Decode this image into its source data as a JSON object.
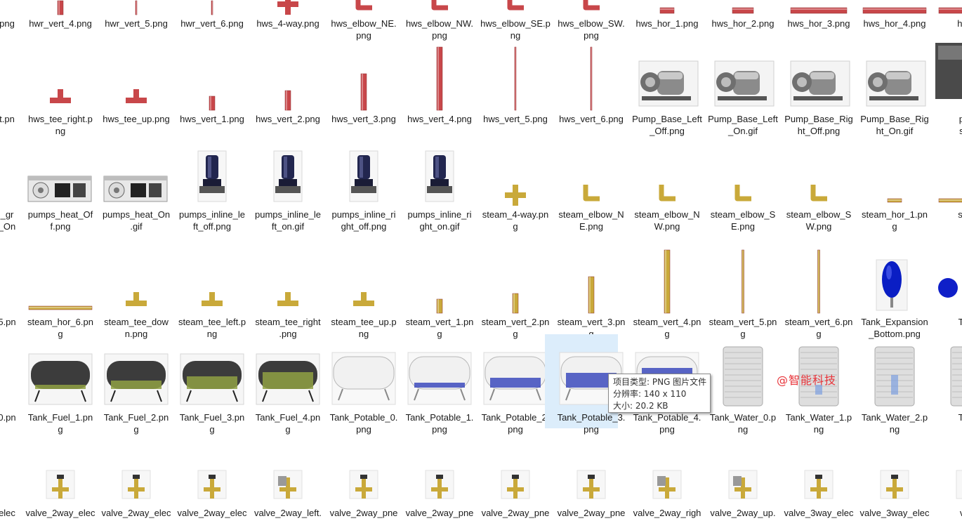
{
  "watermark": "@智能科技",
  "tooltip": {
    "type_line": "项目类型: PNG 图片文件",
    "resolution_line": "分辨率: 140 x 110",
    "size_line": "大小: 20.2 KB"
  },
  "selected_tile": "Tank_Potable_3.png",
  "colors": {
    "pipe_red": "#c8474a",
    "pipe_gold": "#c9a93a",
    "selection": "#dcedfb"
  },
  "rows": [
    {
      "items": [
        {
          "label": "png",
          "icon": "cut-icon"
        },
        {
          "label": "hwr_vert_4.png",
          "icon": "red-vertical-pipe-icon"
        },
        {
          "label": "hwr_vert_5.png",
          "icon": "red-vertical-pipe-icon"
        },
        {
          "label": "hwr_vert_6.png",
          "icon": "red-vertical-pipe-icon"
        },
        {
          "label": "hws_4-way.png",
          "icon": "red-cross-pipe-icon"
        },
        {
          "label": "hws_elbow_NE.\npng",
          "icon": "red-elbow-pipe-icon"
        },
        {
          "label": "hws_elbow_NW.\npng",
          "icon": "red-elbow-pipe-icon"
        },
        {
          "label": "hws_elbow_SE.p\nng",
          "icon": "red-elbow-pipe-icon"
        },
        {
          "label": "hws_elbow_SW.\npng",
          "icon": "red-elbow-pipe-icon"
        },
        {
          "label": "hws_hor_1.png",
          "icon": "red-horizontal-pipe-icon"
        },
        {
          "label": "hws_hor_2.png",
          "icon": "red-horizontal-pipe-icon"
        },
        {
          "label": "hws_hor_3.png",
          "icon": "red-horizontal-pipe-icon"
        },
        {
          "label": "hws_hor_4.png",
          "icon": "red-horizontal-pipe-icon"
        },
        {
          "label": "hws_h",
          "icon": "red-horizontal-pipe-icon"
        }
      ]
    },
    {
      "items": [
        {
          "label": "t.pn",
          "icon": "cut-icon"
        },
        {
          "label": "hws_tee_right.p\nng",
          "icon": "red-tee-pipe-icon"
        },
        {
          "label": "hws_tee_up.png",
          "icon": "red-tee-pipe-icon"
        },
        {
          "label": "hws_vert_1.png",
          "icon": "red-vertical-pipe-icon"
        },
        {
          "label": "hws_vert_2.png",
          "icon": "red-vertical-pipe-icon"
        },
        {
          "label": "hws_vert_3.png",
          "icon": "red-vertical-pipe-icon"
        },
        {
          "label": "hws_vert_4.png",
          "icon": "red-vertical-pipe-icon"
        },
        {
          "label": "hws_vert_5.png",
          "icon": "red-vertical-pipe-icon"
        },
        {
          "label": "hws_vert_6.png",
          "icon": "red-vertical-pipe-icon"
        },
        {
          "label": "Pump_Base_Left\n_Off.png",
          "icon": "pump-base-icon"
        },
        {
          "label": "Pump_Base_Left\n_On.gif",
          "icon": "pump-base-icon"
        },
        {
          "label": "Pump_Base_Rig\nht_Off.png",
          "icon": "pump-base-icon"
        },
        {
          "label": "Pump_Base_Rig\nht_On.gif",
          "icon": "pump-base-icon"
        },
        {
          "label": "pump\nsourc",
          "icon": "pump-source-icon"
        }
      ]
    },
    {
      "items": [
        {
          "label": "_gr\n_On",
          "icon": "cut-icon"
        },
        {
          "label": "pumps_heat_Of\nf.png",
          "icon": "heat-pump-unit-icon"
        },
        {
          "label": "pumps_heat_On\n.gif",
          "icon": "heat-pump-unit-icon"
        },
        {
          "label": "pumps_inline_le\nft_off.png",
          "icon": "inline-pump-icon"
        },
        {
          "label": "pumps_inline_le\nft_on.gif",
          "icon": "inline-pump-icon"
        },
        {
          "label": "pumps_inline_ri\nght_off.png",
          "icon": "inline-pump-icon"
        },
        {
          "label": "pumps_inline_ri\nght_on.gif",
          "icon": "inline-pump-icon"
        },
        {
          "label": "steam_4-way.pn\ng",
          "icon": "gold-cross-pipe-icon"
        },
        {
          "label": "steam_elbow_N\nE.png",
          "icon": "gold-elbow-pipe-icon"
        },
        {
          "label": "steam_elbow_N\nW.png",
          "icon": "gold-elbow-pipe-icon"
        },
        {
          "label": "steam_elbow_S\nE.png",
          "icon": "gold-elbow-pipe-icon"
        },
        {
          "label": "steam_elbow_S\nW.png",
          "icon": "gold-elbow-pipe-icon"
        },
        {
          "label": "steam_hor_1.pn\ng",
          "icon": "gold-horizontal-pipe-icon"
        },
        {
          "label": "steam",
          "icon": "gold-horizontal-pipe-icon"
        }
      ]
    },
    {
      "items": [
        {
          "label": "5.pn",
          "icon": "cut-icon"
        },
        {
          "label": "steam_hor_6.pn\ng",
          "icon": "gold-horizontal-pipe-icon"
        },
        {
          "label": "steam_tee_dow\nn.png",
          "icon": "gold-tee-pipe-icon"
        },
        {
          "label": "steam_tee_left.p\nng",
          "icon": "gold-tee-pipe-icon"
        },
        {
          "label": "steam_tee_right\n.png",
          "icon": "gold-tee-pipe-icon"
        },
        {
          "label": "steam_tee_up.p\nng",
          "icon": "gold-tee-pipe-icon"
        },
        {
          "label": "steam_vert_1.pn\ng",
          "icon": "gold-vertical-pipe-icon"
        },
        {
          "label": "steam_vert_2.pn\ng",
          "icon": "gold-vertical-pipe-icon"
        },
        {
          "label": "steam_vert_3.pn\ng",
          "icon": "gold-vertical-pipe-icon"
        },
        {
          "label": "steam_vert_4.pn\ng",
          "icon": "gold-vertical-pipe-icon"
        },
        {
          "label": "steam_vert_5.pn\ng",
          "icon": "gold-vertical-pipe-icon"
        },
        {
          "label": "steam_vert_6.pn\ng",
          "icon": "gold-vertical-pipe-icon"
        },
        {
          "label": "Tank_Expansion\n_Bottom.png",
          "icon": "expansion-tank-icon"
        },
        {
          "label": "Tank_\n_Le",
          "icon": "expansion-tank-icon"
        }
      ]
    },
    {
      "items": [
        {
          "label": "0.pn",
          "icon": "cut-icon"
        },
        {
          "label": "Tank_Fuel_1.pn\ng",
          "icon": "fuel-tank-icon"
        },
        {
          "label": "Tank_Fuel_2.pn\ng",
          "icon": "fuel-tank-icon"
        },
        {
          "label": "Tank_Fuel_3.pn\ng",
          "icon": "fuel-tank-icon"
        },
        {
          "label": "Tank_Fuel_4.pn\ng",
          "icon": "fuel-tank-icon"
        },
        {
          "label": "Tank_Potable_0.\npng",
          "icon": "potable-tank-icon"
        },
        {
          "label": "Tank_Potable_1.\npng",
          "icon": "potable-tank-icon"
        },
        {
          "label": "Tank_Potable_2.\npng",
          "icon": "potable-tank-icon"
        },
        {
          "label": "Tank_Potable_3.\npng",
          "icon": "potable-tank-icon"
        },
        {
          "label": "Tank_Potable_4.\npng",
          "icon": "potable-tank-icon"
        },
        {
          "label": "Tank_Water_0.p\nng",
          "icon": "water-tank-icon"
        },
        {
          "label": "Tank_Water_1.p\nng",
          "icon": "water-tank-icon"
        },
        {
          "label": "Tank_Water_2.p\nng",
          "icon": "water-tank-icon"
        },
        {
          "label": "Tank_",
          "icon": "water-tank-icon"
        }
      ]
    },
    {
      "items": [
        {
          "label": "elec",
          "icon": "cut-icon"
        },
        {
          "label": "valve_2way_elec",
          "icon": "valve-icon"
        },
        {
          "label": "valve_2way_elec",
          "icon": "valve-icon"
        },
        {
          "label": "valve_2way_elec",
          "icon": "valve-icon"
        },
        {
          "label": "valve_2way_left.",
          "icon": "valve-actuator-icon"
        },
        {
          "label": "valve_2way_pne",
          "icon": "valve-icon"
        },
        {
          "label": "valve_2way_pne",
          "icon": "valve-icon"
        },
        {
          "label": "valve_2way_pne",
          "icon": "valve-icon"
        },
        {
          "label": "valve_2way_pne",
          "icon": "valve-icon"
        },
        {
          "label": "valve_2way_righ",
          "icon": "valve-actuator-icon"
        },
        {
          "label": "valve_2way_up.",
          "icon": "valve-actuator-icon"
        },
        {
          "label": "valve_3way_elec",
          "icon": "valve-icon"
        },
        {
          "label": "valve_3way_elec",
          "icon": "valve-icon"
        },
        {
          "label": "valve",
          "icon": "valve-icon"
        }
      ]
    }
  ]
}
